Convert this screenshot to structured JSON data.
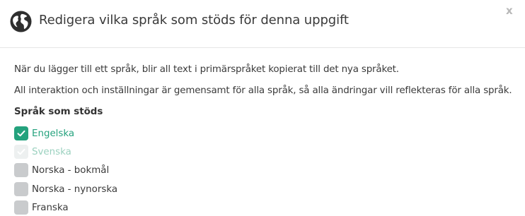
{
  "dialog": {
    "title": "Redigera vilka språk som stöds för denna uppgift",
    "close_label": "x",
    "info_1": "När du lägger till ett språk, blir all text i primärspråket kopierat till det nya språket.",
    "info_2": "All interaktion och inställningar är gemensamt för alla språk, så alla ändringar vill reflekteras för alla språk.",
    "section_label": "Språk som stöds",
    "languages": [
      {
        "label": "Engelska",
        "checked": true,
        "disabled": false
      },
      {
        "label": "Svenska",
        "checked": true,
        "disabled": true
      },
      {
        "label": "Norska - bokmål",
        "checked": false,
        "disabled": false
      },
      {
        "label": "Norska - nynorska",
        "checked": false,
        "disabled": false
      },
      {
        "label": "Franska",
        "checked": false,
        "disabled": false
      }
    ]
  },
  "colors": {
    "accent": "#24a27d",
    "accent_faded": "#9bd1bf",
    "checkbox_off": "#c9cbcd",
    "globe": "#2f2f2f"
  },
  "icons": {
    "header": "globe-icon",
    "close": "close-icon",
    "check": "check-icon"
  }
}
